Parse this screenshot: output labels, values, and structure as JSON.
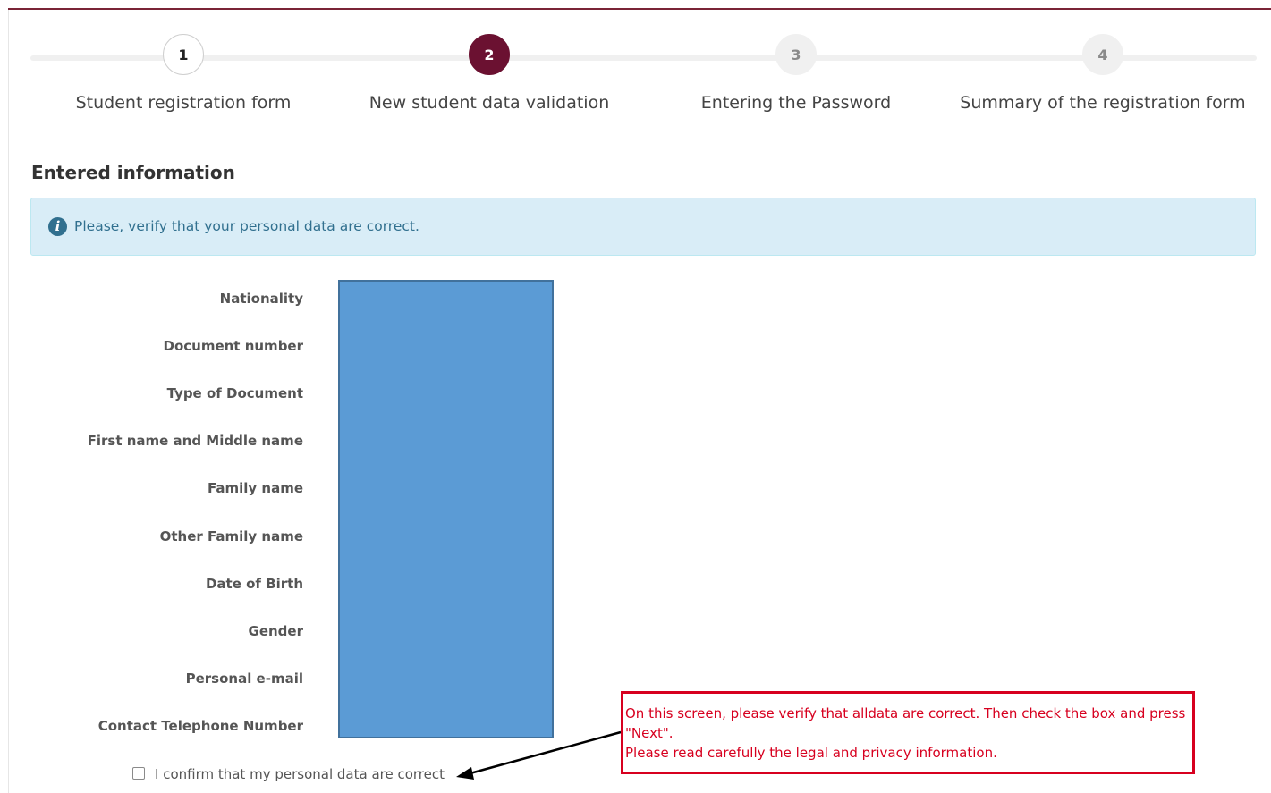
{
  "stepper": {
    "steps": [
      {
        "number": "1",
        "label": "Student registration form",
        "state": "done"
      },
      {
        "number": "2",
        "label": "New student data validation",
        "state": "active"
      },
      {
        "number": "3",
        "label": "Entering the Password",
        "state": "todo"
      },
      {
        "number": "4",
        "label": "Summary of the registration form",
        "state": "todo"
      }
    ],
    "active_color": "#6b1131"
  },
  "section": {
    "title": "Entered information"
  },
  "alert": {
    "icon": "info-icon",
    "text": "Please, verify that your personal data are correct.",
    "color": "#31708f",
    "background": "#d9edf7"
  },
  "fields": {
    "labels": [
      "Nationality",
      "Document number",
      "Type of Document",
      "First name and Middle name",
      "Family name",
      "Other Family name",
      "Date of Birth",
      "Gender",
      "Personal e-mail",
      "Contact Telephone Number"
    ],
    "redaction_color": "#5b9bd5"
  },
  "confirm": {
    "label": "I confirm that my personal data are correct",
    "checked": false
  },
  "callout": {
    "lines": [
      "On this screen, please verify that alldata are correct. Then check the box and press",
      "\"Next\".",
      "Please read carefully the legal and privacy information."
    ],
    "color": "#d7001f"
  }
}
